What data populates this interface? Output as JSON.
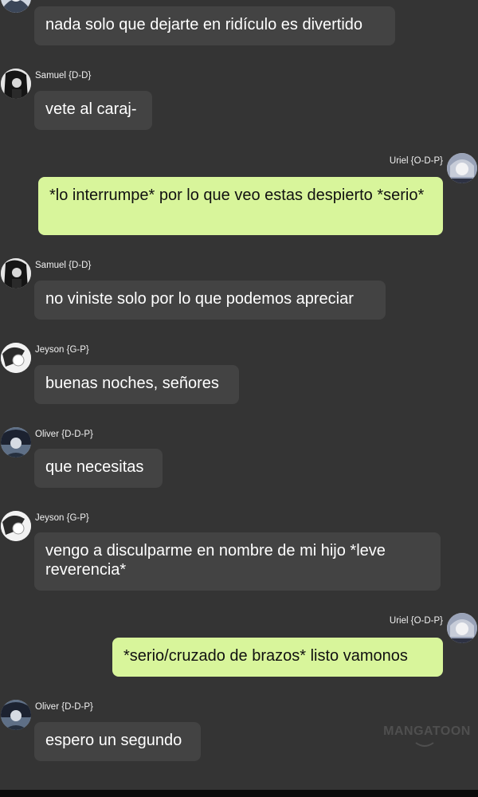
{
  "colors": {
    "background": "#343434",
    "bubble_other": "#434343",
    "bubble_self": "#d8f59b",
    "text_other": "#ffffff",
    "text_self": "#111111"
  },
  "watermark": {
    "text": "MANGATOON"
  },
  "messages": [
    {
      "side": "left",
      "sender": "",
      "avatar_icon": "character-avatar-icon",
      "text": "nada solo que dejarte en ridículo es divertido"
    },
    {
      "side": "left",
      "sender": "Samuel {D-D}",
      "avatar_icon": "samuel-avatar-icon",
      "text": "vete al caraj-"
    },
    {
      "side": "right",
      "sender": "Uriel {O-D-P}",
      "avatar_icon": "uriel-avatar-icon",
      "text": "*lo interrumpe* por lo que veo estas despierto *serio*"
    },
    {
      "side": "left",
      "sender": "Samuel {D-D}",
      "avatar_icon": "samuel-avatar-icon",
      "text": "no viniste solo por lo que podemos apreciar"
    },
    {
      "side": "left",
      "sender": "Jeyson {G-P}",
      "avatar_icon": "jeyson-avatar-icon",
      "text": "buenas noches, señores"
    },
    {
      "side": "left",
      "sender": "Oliver {D-D-P}",
      "avatar_icon": "oliver-avatar-icon",
      "text": "que necesitas"
    },
    {
      "side": "left",
      "sender": "Jeyson {G-P}",
      "avatar_icon": "jeyson-avatar-icon",
      "text": "vengo a disculparme en nombre de mi hijo *leve reverencia*"
    },
    {
      "side": "right",
      "sender": "Uriel {O-D-P}",
      "avatar_icon": "uriel-avatar-icon",
      "text": "*serio/cruzado de brazos* listo vamonos"
    },
    {
      "side": "left",
      "sender": "Oliver {D-D-P}",
      "avatar_icon": "oliver-avatar-icon",
      "text": "espero un segundo"
    }
  ]
}
